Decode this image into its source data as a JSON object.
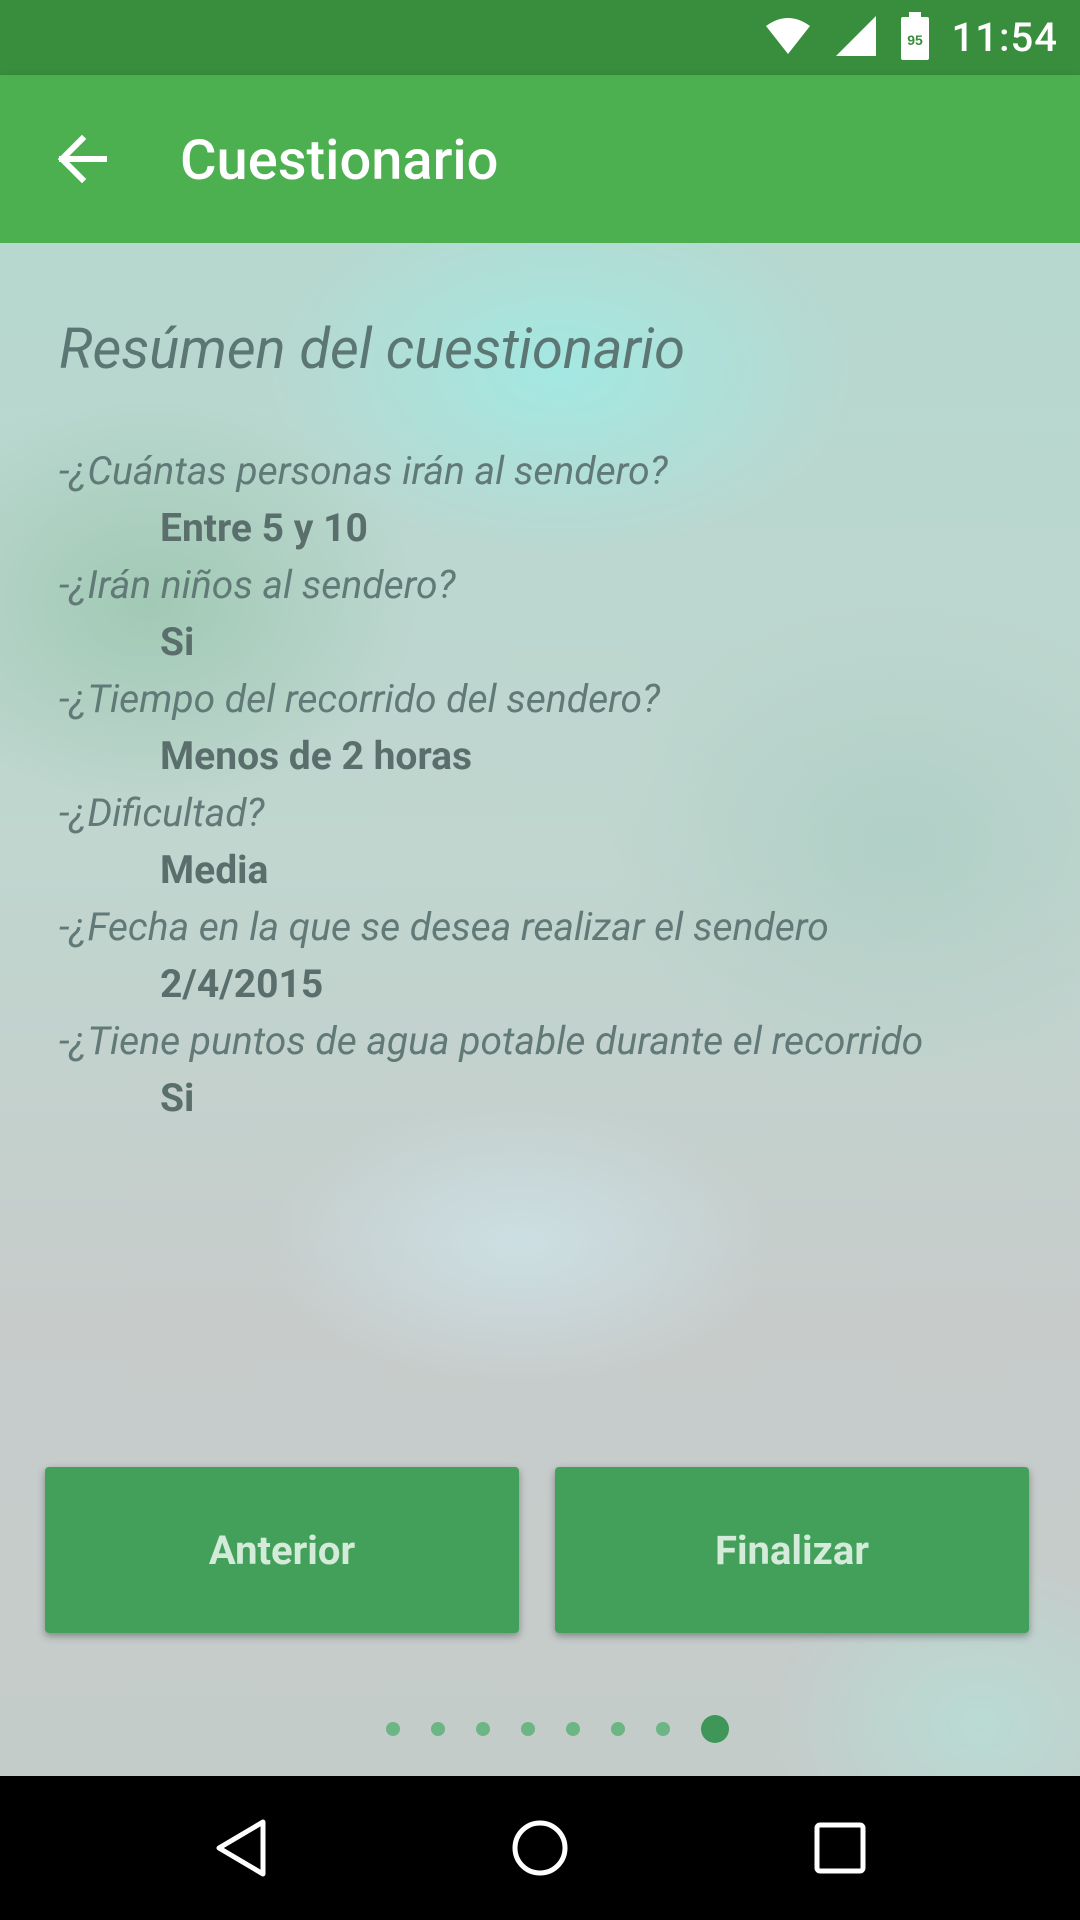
{
  "status_bar": {
    "time": "11:54",
    "battery_level": "95",
    "icons": [
      "wifi-icon",
      "cell-signal-icon",
      "battery-icon"
    ]
  },
  "app_bar": {
    "title": "Cuestionario",
    "back_icon": "arrow-left-icon"
  },
  "summary": {
    "title": "Resúmen del cuestionario",
    "items": [
      {
        "question": "-¿Cuántas personas irán al sendero?",
        "answer": "Entre 5 y 10"
      },
      {
        "question": "-¿Irán niños al sendero?",
        "answer": "Si"
      },
      {
        "question": "-¿Tiempo del recorrido del sendero?",
        "answer": "Menos de 2 horas"
      },
      {
        "question": "-¿Dificultad?",
        "answer": "Media"
      },
      {
        "question": "-¿Fecha en la que se desea realizar el sendero",
        "answer": "2/4/2015"
      },
      {
        "question": "-¿Tiene puntos de agua potable durante el recorrido",
        "answer": "Si"
      }
    ]
  },
  "buttons": {
    "previous_label": "Anterior",
    "finish_label": "Finalizar"
  },
  "pager": {
    "total_pages": 8,
    "current_page": 8
  },
  "nav_bar": {
    "icons": [
      "back-triangle-icon",
      "home-circle-icon",
      "recents-square-icon"
    ]
  },
  "colors": {
    "status_bar": "#388E3C",
    "app_bar": "#4CAF50",
    "button": "#43A05B",
    "dot_active": "#3e9658",
    "dot_inactive": "#6cb584"
  }
}
